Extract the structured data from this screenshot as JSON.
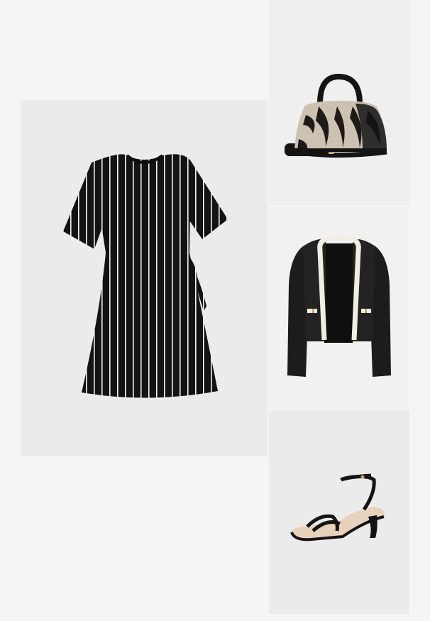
{
  "outfit": {
    "items": [
      {
        "id": "dress",
        "icon": "striped-dress-image",
        "background": "#ebebeb"
      },
      {
        "id": "handbag",
        "icon": "zebra-handbag-image",
        "background": "#efefef"
      },
      {
        "id": "jacket",
        "icon": "tweed-jacket-image",
        "background": "#f1f1f1"
      },
      {
        "id": "sandals",
        "icon": "strappy-sandal-image",
        "background": "#ebebeb"
      }
    ],
    "colors": {
      "page_background": "#f5f5f5",
      "ink": "#141414",
      "trim": "#f2ede2"
    }
  }
}
